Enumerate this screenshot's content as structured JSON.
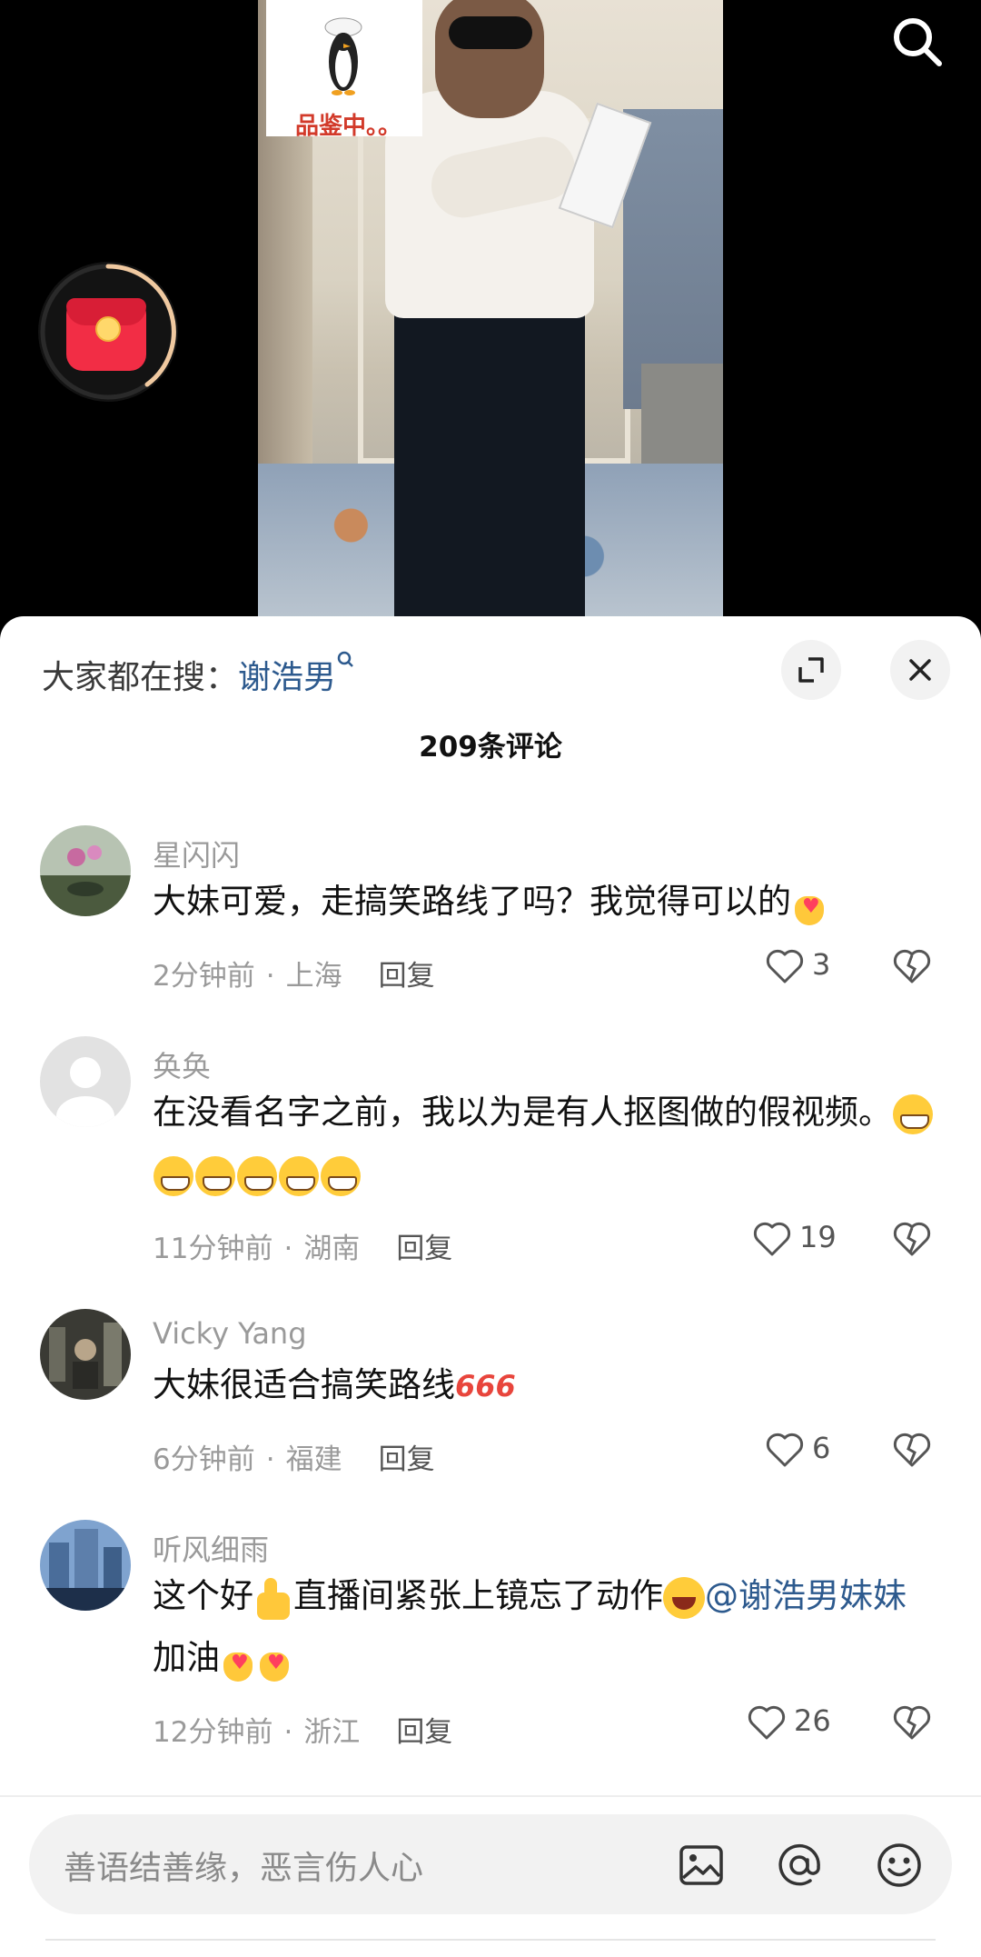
{
  "video": {
    "sticker_text": "品鉴中。。"
  },
  "sheet": {
    "hot_search_label": "大家都在搜：",
    "hot_search_keyword": "谢浩男",
    "comment_count": "209条评论"
  },
  "comments": [
    {
      "username": "星闪闪",
      "text": "大妹可爱，走搞笑路线了吗？我觉得可以的",
      "time": "2分钟前",
      "location": "上海",
      "reply": "回复",
      "likes": "3"
    },
    {
      "username": "奂奂",
      "text": "在没看名字之前，我以为是有人抠图做的假视频。",
      "time": "11分钟前",
      "location": "湖南",
      "reply": "回复",
      "likes": "19"
    },
    {
      "username": "Vicky Yang",
      "text": "大妹很适合搞笑路线",
      "emoji_text": "666",
      "time": "6分钟前",
      "location": "福建",
      "reply": "回复",
      "likes": "6"
    },
    {
      "username": "听风细雨",
      "text_a": "这个好",
      "text_b": "直播间紧张上镜忘了动作",
      "mention": "@谢浩男妹妹",
      "text_c": " 加油",
      "time": "12分钟前",
      "location": "浙江",
      "reply": "回复",
      "likes": "26"
    }
  ],
  "input": {
    "placeholder": "善语结善缘，恶言伤人心"
  },
  "icons": {
    "search": "search-icon",
    "red_packet": "red-packet-icon",
    "expand": "expand-icon",
    "close": "close-icon",
    "like": "heart-icon",
    "dislike": "broken-heart-icon",
    "image": "image-icon",
    "at": "at-icon",
    "emoji": "emoji-icon"
  },
  "colors": {
    "mention": "#2d5a8e",
    "secondary_text": "#9a9a9a",
    "red_packet": "#f22d45"
  }
}
